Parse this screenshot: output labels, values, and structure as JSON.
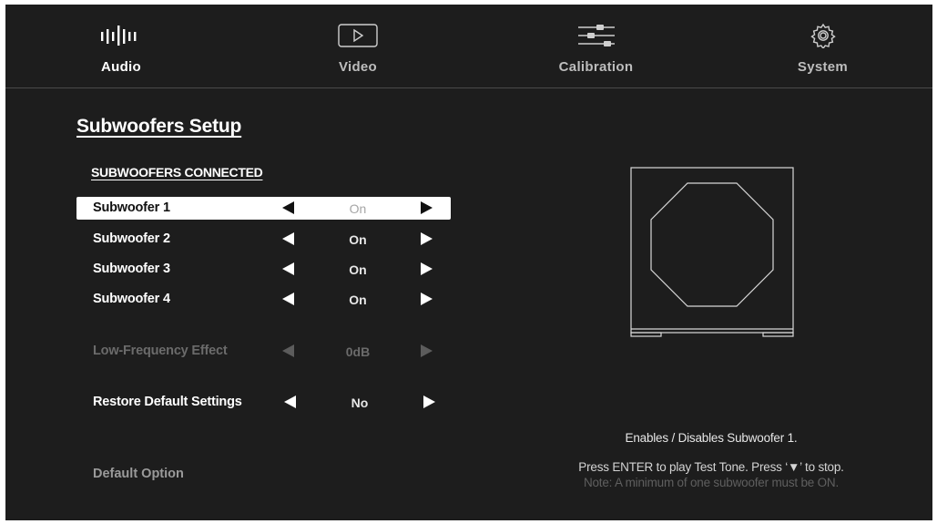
{
  "tabs": [
    {
      "label": "Audio",
      "icon": "audio-bars-icon",
      "active": true
    },
    {
      "label": "Video",
      "icon": "play-icon",
      "active": false
    },
    {
      "label": "Calibration",
      "icon": "sliders-icon",
      "active": false
    },
    {
      "label": "System",
      "icon": "gear-icon",
      "active": false
    }
  ],
  "page": {
    "title": "Subwoofers Setup",
    "section_title": "SUBWOOFERS CONNECTED"
  },
  "settings": [
    {
      "label": "Subwoofer 1",
      "value": "On",
      "state": "selected"
    },
    {
      "label": "Subwoofer 2",
      "value": "On",
      "state": "normal"
    },
    {
      "label": "Subwoofer 3",
      "value": "On",
      "state": "normal"
    },
    {
      "label": "Subwoofer 4",
      "value": "On",
      "state": "normal"
    },
    {
      "label": "Low-Frequency Effect",
      "value": "0dB",
      "state": "disabled"
    },
    {
      "label": "Restore Default Settings",
      "value": "No",
      "state": "normal"
    }
  ],
  "footer": {
    "default_option": "Default Option"
  },
  "help": {
    "description": "Enables / Disables Subwoofer 1.",
    "test_tone": "Press ENTER to play Test Tone. Press ‘▼’ to stop.",
    "note": "Note: A minimum of one subwoofer must be ON."
  },
  "colors": {
    "background": "#1d1d1d",
    "text": "#ffffff",
    "disabled": "#6b6b6b",
    "selected_row": "#ffffff"
  }
}
